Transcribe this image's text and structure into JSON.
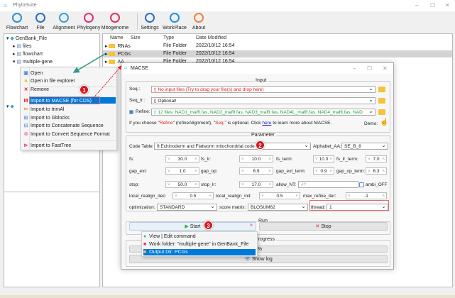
{
  "app": {
    "title": "PhyloSuite"
  },
  "toolbar": [
    {
      "label": "Flowchart",
      "icon": "flowchart-icon",
      "color": "#2b8fd8"
    },
    {
      "label": "File",
      "icon": "file-import-icon",
      "color": "#2b6fb8"
    },
    {
      "label": "Alignment",
      "icon": "atom-icon",
      "color": "#3a9fd6"
    },
    {
      "label": "Phylogeny",
      "icon": "share-tree-icon",
      "color": "#e0307a"
    },
    {
      "label": "Mitogenome",
      "icon": "ring-icon",
      "color": "#e0305a"
    },
    {
      "label": "Settings",
      "icon": "gears-icon",
      "color": "#2b6fb8"
    },
    {
      "label": "WorkPlace",
      "icon": "workplace-icon",
      "color": "#1e90e8"
    },
    {
      "label": "About",
      "icon": "info-icon",
      "color": "#f08040"
    }
  ],
  "tree": {
    "items": [
      "GenBank_File",
      "files",
      "flowchart",
      "multiple-gene"
    ]
  },
  "files": {
    "headers": [
      "Name",
      "Size",
      "Type",
      "Date Modified"
    ],
    "rows": [
      {
        "name": "RNAs",
        "type": "File Folder",
        "date": "2022/10/12 16:54"
      },
      {
        "name": "PCGs",
        "type": "File Folder",
        "date": "2022/10/12 16:54"
      },
      {
        "name": "AA",
        "type": "File Folder",
        "date": "2022/10/12 16:54"
      }
    ]
  },
  "context_menu": [
    "Open",
    "Open in file explorer",
    "Remove",
    "Import to MACSE (for CDS)",
    "Import to trimAl",
    "Import to Gblocks",
    "Import to Concatenate Sequence",
    "Import to Convert Sequence Format",
    "Import to FastTree"
  ],
  "badges": [
    "1",
    "2",
    "3"
  ],
  "macse": {
    "title": "MACSE",
    "input": {
      "group": "Input",
      "seq_label": "Seq.:",
      "seq_value": "No input files (Try to drag your file(s) and drop here)",
      "seq_lr_label": "Seq_lr.:",
      "seq_lr_value": "Optional!",
      "refine_label": "Refine:",
      "refine_value": "12 files: NAD1_mafft.fas, NAD2_mafft.fas, NAD3_mafft.fas, NAD4L_mafft.fas, NAD4_mafft.fas, NAD",
      "info_a": "If you choose \"",
      "info_refine": "Refine",
      "info_b": "\" (refineAlignment), \"",
      "info_seq": "Seq.",
      "info_c": "\" is optional. Click ",
      "info_link": "here",
      "info_d": " to learn more about MACSE.",
      "demo": "Demo:"
    },
    "param": {
      "group": "Parameter",
      "code_table_label": "Code Table:",
      "code_table": "9 Echinoderm and Flatworm mitochondrial code",
      "alphabet_label": "Alphabet_AA:",
      "alphabet": "SE_B_8",
      "fs": "30.0",
      "fs_lr": "10.0",
      "fs_term": "10.0",
      "fs_lr_term": "7.0",
      "gap_ext": "1.0",
      "gap_op": "6.9",
      "gap_ext_term": "0.9",
      "gap_op_term": "6.3",
      "stop": "50.0",
      "stop_lr": "17.0",
      "allow_nt_placeholder": "#?",
      "ambi_off": "ambi_OFF",
      "local_realign_dec": "0.5",
      "local_realign_init": "0.5",
      "max_refine_iter": "-1",
      "optimization": "STANDARD",
      "score_matrix": "BLOSUM62",
      "thread": "1",
      "labels": {
        "fs": "fs:",
        "fs_lr": "fs_lr:",
        "fs_term": "fs_term:",
        "fs_lr_term": "fs_lr_term:",
        "gap_ext": "gap_ext:",
        "gap_op": "gap_op:",
        "gap_ext_term": "gap_ext_term:",
        "gap_op_term": "gap_op_term:",
        "stop": "stop:",
        "stop_lr": "stop_lr:",
        "allow_nt": "allow_NT:",
        "local_realign_dec": "local_realign_dec:",
        "local_realign_init": "local_realign_init:",
        "max_refine_iter": "max_refine_iter:",
        "optimization": "optimization:",
        "score_matrix": "score matrix:",
        "thread": "thread:"
      }
    },
    "run": {
      "group": "Run",
      "start": "Start",
      "stop": "Stop"
    },
    "progress": {
      "group": "Progress",
      "value": "0%",
      "show_log": "Show log"
    },
    "start_menu": [
      "View | Edit command",
      "Work folder: \"multiple-gene\" in GenBank_File",
      "Output Dir: PCGs"
    ]
  }
}
